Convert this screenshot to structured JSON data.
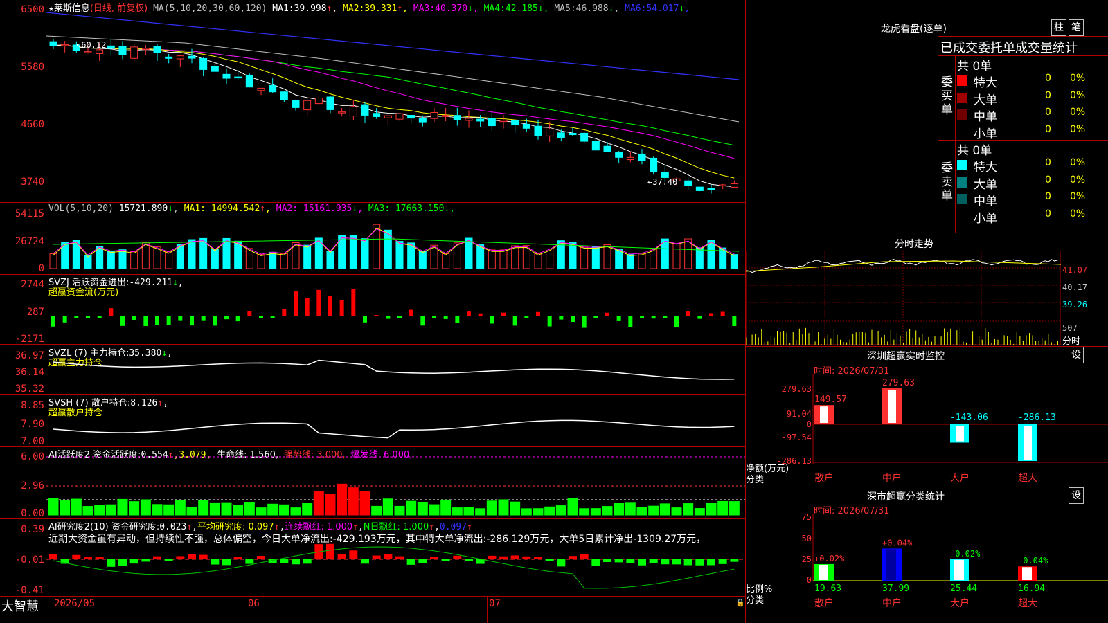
{
  "stock": {
    "name": "莱斯信息",
    "period": "(日线, 前复权)",
    "ma_label": "MA(5,10,20,30,60,120)",
    "ma": [
      {
        "label": "MA1:",
        "value": "39.998",
        "arrow": "↑",
        "color": "#ffffff"
      },
      {
        "label": "MA2:",
        "value": "39.331",
        "arrow": "↑",
        "color": "#ffff00"
      },
      {
        "label": "MA3:",
        "value": "40.370",
        "arrow": "↓",
        "color": "#ff00ff"
      },
      {
        "label": "MA4:",
        "value": "42.185",
        "arrow": "↓",
        "color": "#00ff00"
      },
      {
        "label": "MA5:",
        "value": "46.988",
        "arrow": "↓",
        "color": "#c0c0c0"
      },
      {
        "label": "MA6:",
        "value": "54.017",
        "arrow": "↓",
        "color": "#3232ff"
      }
    ],
    "high_label": "60.12",
    "low_label": "37.40",
    "axis": [
      "6500",
      "5580",
      "4660",
      "3740"
    ]
  },
  "volume": {
    "label": "VOL(5,10,20)",
    "value": "15721.890",
    "arrow": "↓",
    "ma": [
      {
        "label": "MA1:",
        "value": "14994.542",
        "arrow": "↑",
        "color": "#ffff00"
      },
      {
        "label": "MA2:",
        "value": "15161.935",
        "arrow": "↓",
        "color": "#ff00ff"
      },
      {
        "label": "MA3:",
        "value": "17663.150",
        "arrow": "↓",
        "color": "#00ff00"
      }
    ],
    "axis": [
      "54115",
      "26724",
      "0"
    ]
  },
  "svzj": {
    "label": "SVZJ  活跃资金进出:",
    "value": "-429.211",
    "arrow": "↓",
    "sub": "超赢资金流(万元)",
    "axis": [
      "2744",
      "287",
      "-2171"
    ]
  },
  "svzl": {
    "label": "SVZL (7) 主力持仓:",
    "value": "35.380",
    "arrow": "↓",
    "tail": ",",
    "sub": "超赢主力持仓",
    "axis": [
      "36.97",
      "36.14",
      "35.32"
    ]
  },
  "svsh": {
    "label": "SVSH (7) 散户持仓:",
    "value": "8.126",
    "arrow": "↑",
    "tail": ",",
    "sub": "超赢散户持仓",
    "axis": [
      "8.85",
      "7.90",
      "7.00"
    ]
  },
  "ai_active": {
    "label": "AI活跃度2 资金活跃度:",
    "value": "0.554",
    "arrow": "↑",
    "second": ",3.079,",
    "life": "生命线: 1.560,",
    "strong": "强势线: 3.000,",
    "burst": "爆发线: 6.000,",
    "axis": [
      "6.00",
      "2.96",
      "0.00"
    ]
  },
  "ai_research": {
    "label": "AI研究度2(10) 资金研究度:",
    "value": "0.023",
    "arrow": "↑",
    "tail": ",",
    "avg": "平均研究度: 0.097",
    "avg_arrow": "↑",
    "tail2": ",",
    "red1": "连续飘红: 1.000",
    "red1_arrow": "↑",
    "tail3": ",",
    "red2": "N日飘红: 1.000",
    "red2_arrow": "↑",
    "tail4": ",",
    "last": "0.097",
    "last_arrow": "↑",
    "comment": "近期大资金虽有异动，但持续性不强，总体偏空，今日大单净流出:-429.193万元，其中特大单净流出:-286.129万元，大单5日累计净出-1309.27万元，",
    "axis": [
      "0.39",
      "-0.01",
      "-0.41"
    ]
  },
  "x_axis": [
    "2026/05",
    "06",
    "07"
  ],
  "brand": "大智慧",
  "right": {
    "header_title": "龙虎看盘(逐单)",
    "btn_bar": "柱",
    "btn_pen": "笔",
    "stats_title": "已成交委托单成交量统计",
    "buy_label": "委买单",
    "sell_label": "委卖单",
    "buy_total": "共 0单",
    "sell_total": "共 0单",
    "buy_rows": [
      {
        "name": "特大",
        "color": "#ff0000",
        "count": "0",
        "pct": "0%"
      },
      {
        "name": "大单",
        "color": "#a00000",
        "count": "0",
        "pct": "0%"
      },
      {
        "name": "中单",
        "color": "#700000",
        "count": "0",
        "pct": "0%"
      },
      {
        "name": "小单",
        "color": "",
        "count": "0",
        "pct": "0%"
      }
    ],
    "sell_rows": [
      {
        "name": "特大",
        "color": "#00ffff",
        "count": "0",
        "pct": "0%"
      },
      {
        "name": "大单",
        "color": "#008080",
        "count": "0",
        "pct": "0%"
      },
      {
        "name": "中单",
        "color": "#006060",
        "count": "0",
        "pct": "0%"
      },
      {
        "name": "小单",
        "color": "",
        "count": "0",
        "pct": "0%"
      }
    ],
    "intraday_title": "分时走势",
    "intraday_axis": [
      "41.07",
      "40.17",
      "39.26"
    ],
    "intraday_vol": "507",
    "intraday_unit": "分时",
    "monitor_title": "深圳超赢实时监控",
    "monitor_btn": "设",
    "monitor_time": "时间: 2026/07/31",
    "monitor_axis": [
      "279.63",
      "91.04",
      "0",
      "-97.54",
      "-286.13"
    ],
    "monitor_bars": [
      {
        "cat": "散户",
        "value": "149.57"
      },
      {
        "cat": "中户",
        "value": "279.63"
      },
      {
        "cat": "大户",
        "value": "-143.06"
      },
      {
        "cat": "超大",
        "value": "-286.13"
      }
    ],
    "monitor_unit": "净额(万元)",
    "monitor_cat": "分类",
    "class_title": "深市超赢分类统计",
    "class_btn": "设",
    "class_time": "时间: 2026/07/31",
    "class_axis": [
      "75",
      "50",
      "25",
      "0"
    ],
    "class_bars": [
      {
        "cat": "散户",
        "pct": "19.63",
        "chg": "+0.02%"
      },
      {
        "cat": "中户",
        "pct": "37.99",
        "chg": "+0.04%"
      },
      {
        "cat": "大户",
        "pct": "25.44",
        "chg": "-0.02%"
      },
      {
        "cat": "超大",
        "pct": "16.94",
        "chg": "-0.04%"
      }
    ],
    "class_unit": "比例%",
    "class_cat": "分类"
  }
}
